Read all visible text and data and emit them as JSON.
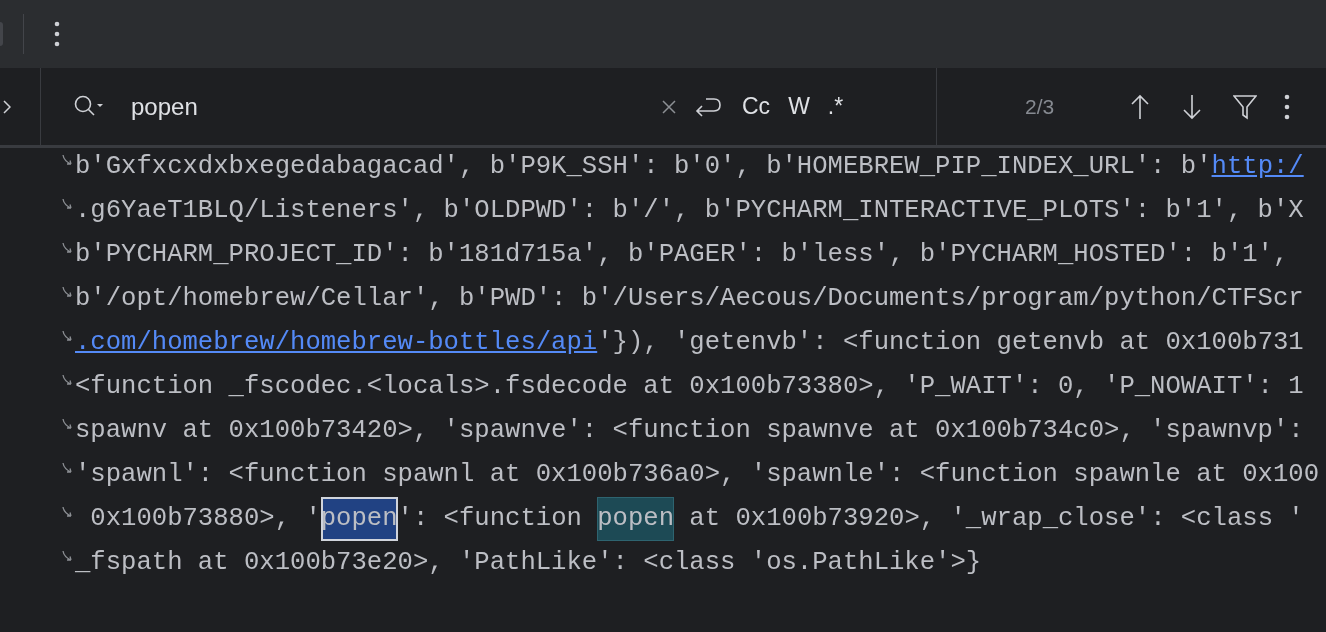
{
  "search": {
    "value": "popen",
    "options": [
      {
        "label": "Cc",
        "selected": false
      },
      {
        "label": "W",
        "selected": false
      },
      {
        "label": ".*",
        "selected": false
      }
    ],
    "match_count": "2/3"
  },
  "console": {
    "lines": [
      {
        "segments": [
          {
            "kind": "text",
            "text": "b'Gxfxcxdxbxegedabagacad', b'P9K_SSH': b'0', b'HOMEBREW_PIP_INDEX_URL': b'"
          },
          {
            "kind": "link",
            "text": "http:/"
          }
        ]
      },
      {
        "segments": [
          {
            "kind": "text",
            "text": ".g6YaeT1BLQ/Listeners', b'OLDPWD': b'/', b'PYCHARM_INTERACTIVE_PLOTS': b'1', b'X"
          }
        ]
      },
      {
        "segments": [
          {
            "kind": "text",
            "text": "b'PYCHARM_PROJECT_ID': b'181d715a', b'PAGER': b'less', b'PYCHARM_HOSTED': b'1',"
          }
        ]
      },
      {
        "segments": [
          {
            "kind": "text",
            "text": "b'/opt/homebrew/Cellar', b'PWD': b'/Users/Aecous/Documents/program/python/CTFScr"
          }
        ]
      },
      {
        "segments": [
          {
            "kind": "link",
            "text": ".com/homebrew/homebrew-bottles/api"
          },
          {
            "kind": "text",
            "text": "'}), 'getenvb': <function getenvb at 0x100b731"
          }
        ]
      },
      {
        "segments": [
          {
            "kind": "text",
            "text": "<function _fscodec.<locals>.fsdecode at 0x100b73380>, 'P_WAIT': 0, 'P_NOWAIT': 1"
          }
        ]
      },
      {
        "segments": [
          {
            "kind": "text",
            "text": "spawnv at 0x100b73420>, 'spawnve': <function spawnve at 0x100b734c0>, 'spawnvp':"
          }
        ]
      },
      {
        "segments": [
          {
            "kind": "text",
            "text": "'spawnl': <function spawnl at 0x100b736a0>, 'spawnle': <function spawnle at 0x100"
          }
        ]
      },
      {
        "segments": [
          {
            "kind": "text",
            "text": " 0x100b73880>, '"
          },
          {
            "kind": "match",
            "text": "popen",
            "selected": true
          },
          {
            "kind": "text",
            "text": "': <function "
          },
          {
            "kind": "match",
            "text": "popen",
            "selected": false
          },
          {
            "kind": "text",
            "text": " at 0x100b73920>, '_wrap_close': <class '"
          }
        ]
      },
      {
        "segments": [
          {
            "kind": "text",
            "text": "_fspath at 0x100b73e20>, 'PathLike': <class 'os.PathLike'>}"
          }
        ]
      }
    ]
  }
}
